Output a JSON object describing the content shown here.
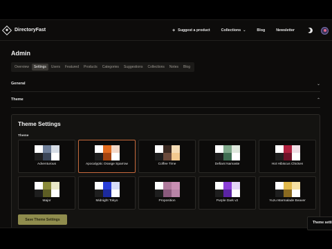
{
  "brand": {
    "name": "DirectoryFast"
  },
  "nav": {
    "suggest": "Suggest a product",
    "collections": "Collections",
    "blog": "Blog",
    "newsletter": "Newsletter"
  },
  "page": {
    "title": "Admin"
  },
  "tabs": [
    "Overview",
    "Settings",
    "Users",
    "Featured",
    "Products",
    "Categories",
    "Suggestions",
    "Collections",
    "Notes",
    "Blog"
  ],
  "active_tab": "Settings",
  "sections": {
    "general": "General",
    "theme": "Theme"
  },
  "theme_settings": {
    "title": "Theme Settings",
    "label": "Theme",
    "save_label": "Save Theme Settings",
    "selected": "Apocalyptic Orange Sparrow",
    "themes": [
      {
        "name": "Adventurous",
        "colors": [
          "#ffffff",
          "#6f7f99",
          "#d6dde6",
          "#1e1e1e",
          "#3b4658",
          "#ffffff"
        ]
      },
      {
        "name": "Apocalyptic Orange Sparrow",
        "colors": [
          "#ffffff",
          "#e26b1e",
          "#f4d8c7",
          "#1e1e1e",
          "#a4440f",
          "#ffffff"
        ]
      },
      {
        "name": "Coffee Time",
        "colors": [
          "#ffffff",
          "#3b2a22",
          "#f6ddb6",
          "#1e1e1e",
          "#6b4a3b",
          "#f3c98f"
        ]
      },
      {
        "name": "Defiant Namaste",
        "colors": [
          "#ffffff",
          "#7fa88a",
          "#dfe8dd",
          "#1e1e1e",
          "#3f6e52",
          "#ffffff"
        ]
      },
      {
        "name": "Hot Hibiscus Chicken",
        "colors": [
          "#ffffff",
          "#b0213f",
          "#f0dfe6",
          "#1e1e1e",
          "#6f1228",
          "#ffffff"
        ]
      },
      {
        "name": "Major",
        "colors": [
          "#ffffff",
          "#8a8a3a",
          "#e9e8c8",
          "#1e1e1e",
          "#5d5d24",
          "#ffffff"
        ]
      },
      {
        "name": "Midnight Tokyo",
        "colors": [
          "#ffffff",
          "#2a3fd8",
          "#d6dcf8",
          "#1e1e1e",
          "#1c2a9c",
          "#ffffff"
        ]
      },
      {
        "name": "Proposition",
        "colors": [
          "#ffffff",
          "#b07a9c",
          "#c98fb3",
          "#1e1e1e",
          "#8a5a7c",
          "#b884a6"
        ]
      },
      {
        "name": "Purple Dark v2",
        "colors": [
          "#ffffff",
          "#8b3fd8",
          "#e3d4f6",
          "#1e1e1e",
          "#5b24a4",
          "#ffffff"
        ]
      },
      {
        "name": "Yuzu Marmalade Beaver",
        "colors": [
          "#ffffff",
          "#e0b84a",
          "#f6e0a3",
          "#1e1e1e",
          "#8a6a20",
          "#ffffff"
        ]
      }
    ]
  },
  "toast": {
    "text": "Theme setti"
  }
}
